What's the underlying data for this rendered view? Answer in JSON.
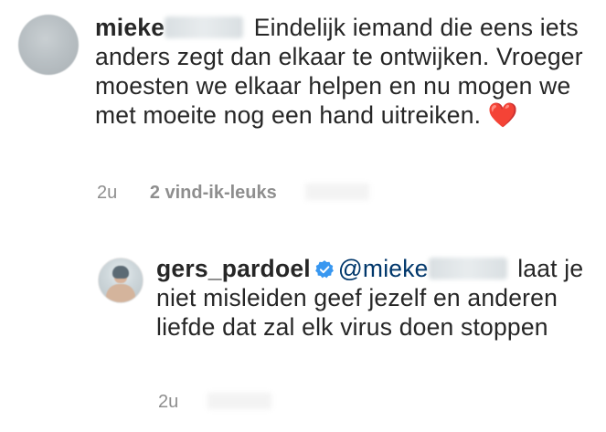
{
  "comments": [
    {
      "username": "mieke",
      "text": "Eindelijk iemand die eens iets anders zegt dan elkaar te ontwijken. Vroeger moesten we elkaar helpen en nu mogen we met moeite nog een hand uitreiken. ❤️",
      "time": "2u",
      "likes": "2 vind-ik-leuks"
    }
  ],
  "reply": {
    "username": "gers_pardoel",
    "mention": "@mieke",
    "text": "laat je niet misleiden geef jezelf en anderen liefde dat zal elk virus doen stoppen",
    "time": "2u"
  },
  "icons": {
    "verified": "verified-badge-icon"
  },
  "colors": {
    "text": "#262626",
    "meta": "#8e8e8e",
    "mention": "#00376b",
    "verified": "#3897f0"
  }
}
